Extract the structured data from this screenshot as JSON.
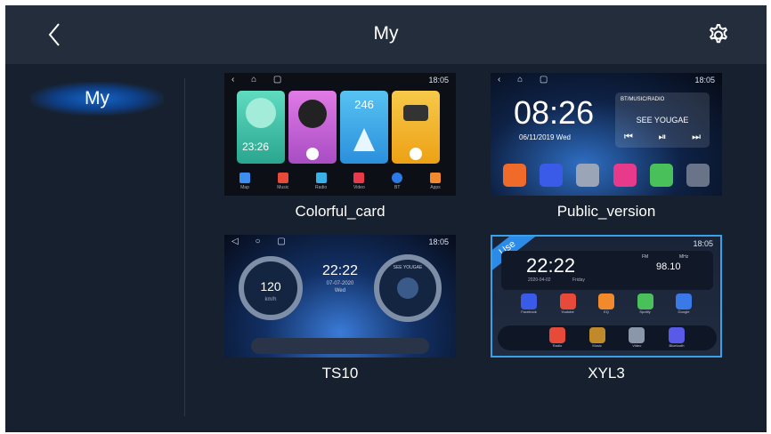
{
  "header": {
    "title": "My"
  },
  "sidebar": {
    "items": [
      {
        "label": "My",
        "selected": true
      }
    ]
  },
  "themes": [
    {
      "label": "Colorful_card",
      "thumb": {
        "status_time": "18:05",
        "widgets": [
          {
            "text": "23:26",
            "color": "#3ec0a8"
          },
          {
            "text": "",
            "color": "#c45fd6"
          },
          {
            "text": "246",
            "color": "#3aa7e8"
          },
          {
            "text": "",
            "color": "#f2b51d"
          }
        ],
        "dock": [
          "Map",
          "Music",
          "Radio",
          "Video",
          "BT",
          "Apps"
        ]
      }
    },
    {
      "label": "Public_version",
      "thumb": {
        "status_time": "18:05",
        "clock": "08:26",
        "date": "06/11/2019 Wed",
        "media_source": "BT/MUSIC/RADIO",
        "track": "SEE YOUGAE"
      }
    },
    {
      "label": "TS10",
      "thumb": {
        "status_time": "18:05",
        "clock": "22:22",
        "date": "07-07-2020",
        "day": "Wed",
        "speed": "120",
        "speed_unit": "km/h",
        "track": "SEE YOUGAE"
      }
    },
    {
      "label": "XYL3",
      "in_use": true,
      "badge": "Use",
      "thumb": {
        "status_time": "18:05",
        "clock": "22:22",
        "date": "2020-04-02",
        "day": "Friday",
        "band": "FM",
        "unit": "MHz",
        "frequency": "98.10",
        "apps_row1": [
          "Facebook",
          "Youtube",
          "EQ",
          "Spotify",
          "Google"
        ],
        "apps_row2": [
          "Radio",
          "Music",
          "Video",
          "Bluetooth"
        ]
      }
    }
  ],
  "colors": {
    "background": "#17202e",
    "header": "#232d3c",
    "accent": "#1565c8",
    "selected_border": "#3aa0e8"
  }
}
